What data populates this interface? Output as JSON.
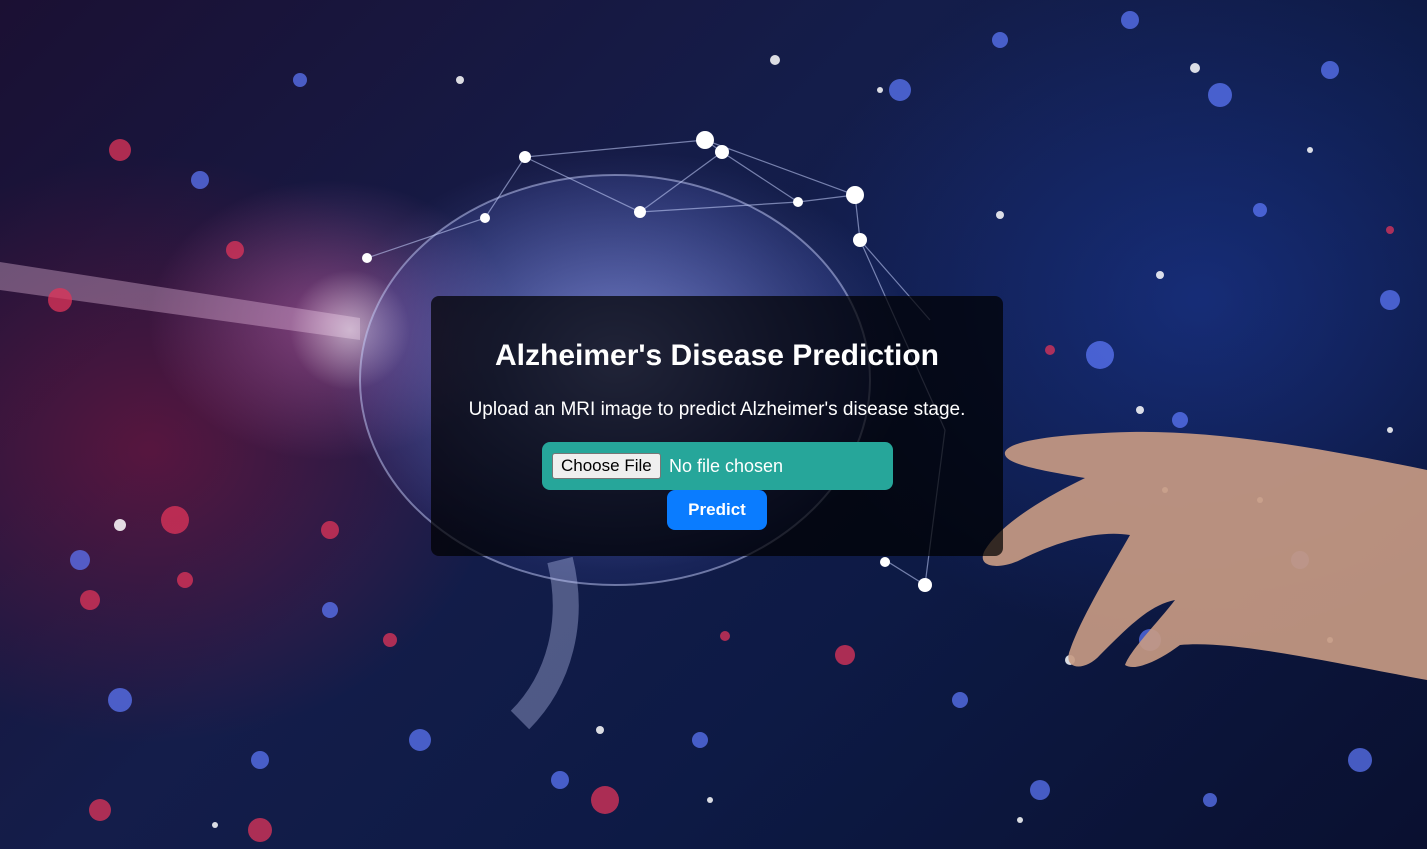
{
  "page": {
    "title": "Alzheimer's Disease Prediction",
    "subtitle": "Upload an MRI image to predict Alzheimer's disease stage."
  },
  "upload": {
    "choose_label": "Choose File",
    "status": "No file chosen"
  },
  "actions": {
    "predict_label": "Predict"
  },
  "background": {
    "description_icon": "brain-network-hand-icon"
  },
  "colors": {
    "card_bg": "#000000",
    "file_box": "#26a69a",
    "predict_button": "#0a7cff"
  }
}
